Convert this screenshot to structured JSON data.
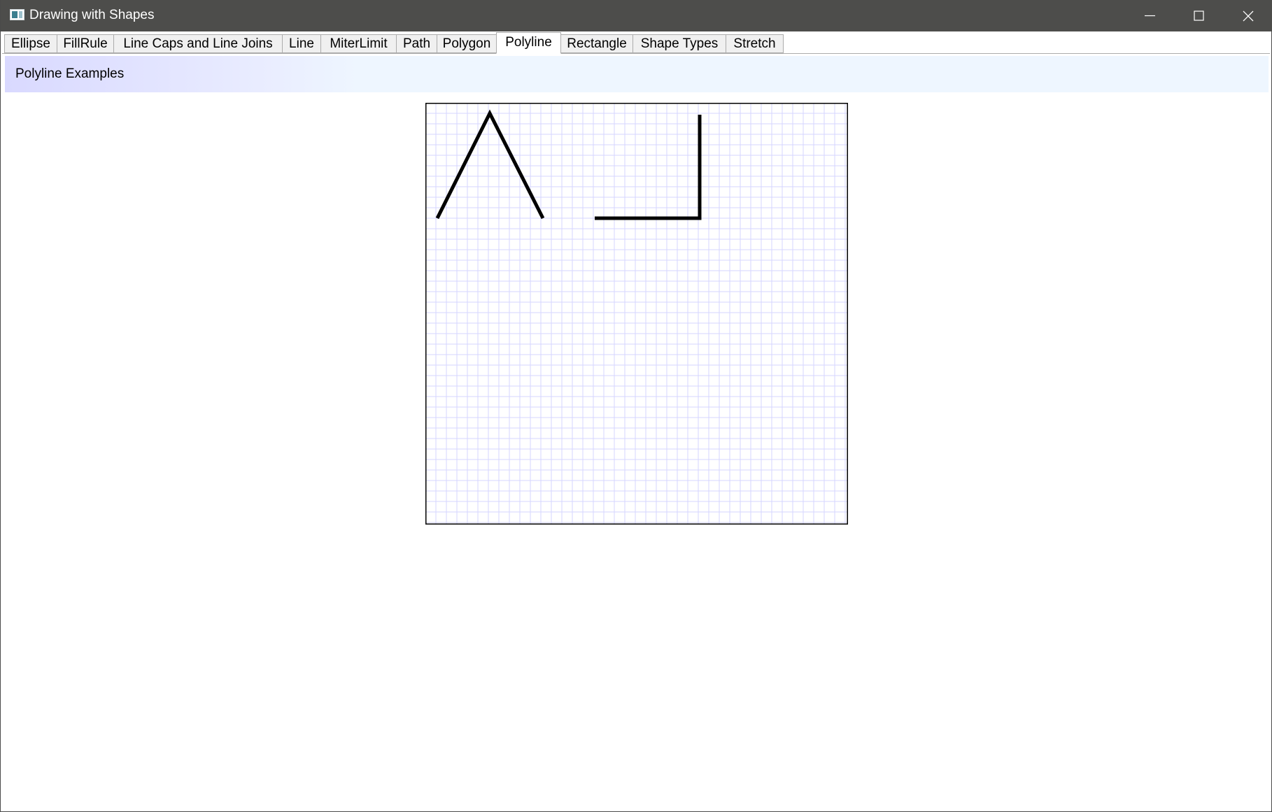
{
  "window": {
    "title": "Drawing with Shapes",
    "icons": {
      "app": "app-window-icon",
      "minimize": "minimize-icon",
      "maximize": "maximize-icon",
      "close": "close-icon"
    }
  },
  "tabs": [
    {
      "label": "Ellipse",
      "selected": false
    },
    {
      "label": "FillRule",
      "selected": false
    },
    {
      "label": "Line Caps and Line Joins",
      "selected": false
    },
    {
      "label": "Line",
      "selected": false
    },
    {
      "label": "MiterLimit",
      "selected": false
    },
    {
      "label": "Path",
      "selected": false
    },
    {
      "label": "Polygon",
      "selected": false
    },
    {
      "label": "Polyline",
      "selected": true
    },
    {
      "label": "Rectangle",
      "selected": false
    },
    {
      "label": "Shape Types",
      "selected": false
    },
    {
      "label": "Stretch",
      "selected": false
    }
  ],
  "content": {
    "header": "Polyline Examples"
  },
  "colors": {
    "titlebar": "#4d4d4b",
    "grid_line": "#d6d6ff",
    "canvas_border": "#000000",
    "polyline_stroke": "#000000",
    "header_gradient_start": "#d9d9ff",
    "header_gradient_end": "#eef6ff"
  }
}
